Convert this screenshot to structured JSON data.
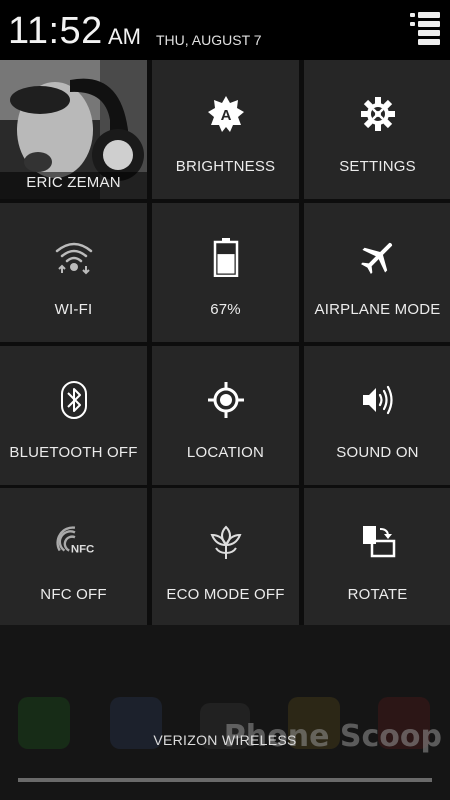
{
  "status_bar": {
    "time": "11:52",
    "ampm": "AM",
    "date": "THU, AUGUST 7"
  },
  "profile": {
    "name": "ERIC ZEMAN"
  },
  "tiles": [
    {
      "label": "BRIGHTNESS",
      "icon": "brightness-auto-icon"
    },
    {
      "label": "SETTINGS",
      "icon": "gear-icon"
    },
    {
      "label": "WI-FI",
      "icon": "wifi-icon"
    },
    {
      "label": "67%",
      "icon": "battery-icon",
      "battery_level": 0.67
    },
    {
      "label": "AIRPLANE MODE",
      "icon": "airplane-icon"
    },
    {
      "label": "BLUETOOTH OFF",
      "icon": "bluetooth-icon"
    },
    {
      "label": "LOCATION",
      "icon": "location-icon"
    },
    {
      "label": "SOUND ON",
      "icon": "speaker-icon"
    },
    {
      "label": "NFC OFF",
      "icon": "nfc-icon"
    },
    {
      "label": "ECO MODE OFF",
      "icon": "leaf-icon"
    },
    {
      "label": "ROTATE",
      "icon": "rotate-icon"
    }
  ],
  "carrier": "VERIZON WIRELESS",
  "watermark": "Phone Scoop"
}
